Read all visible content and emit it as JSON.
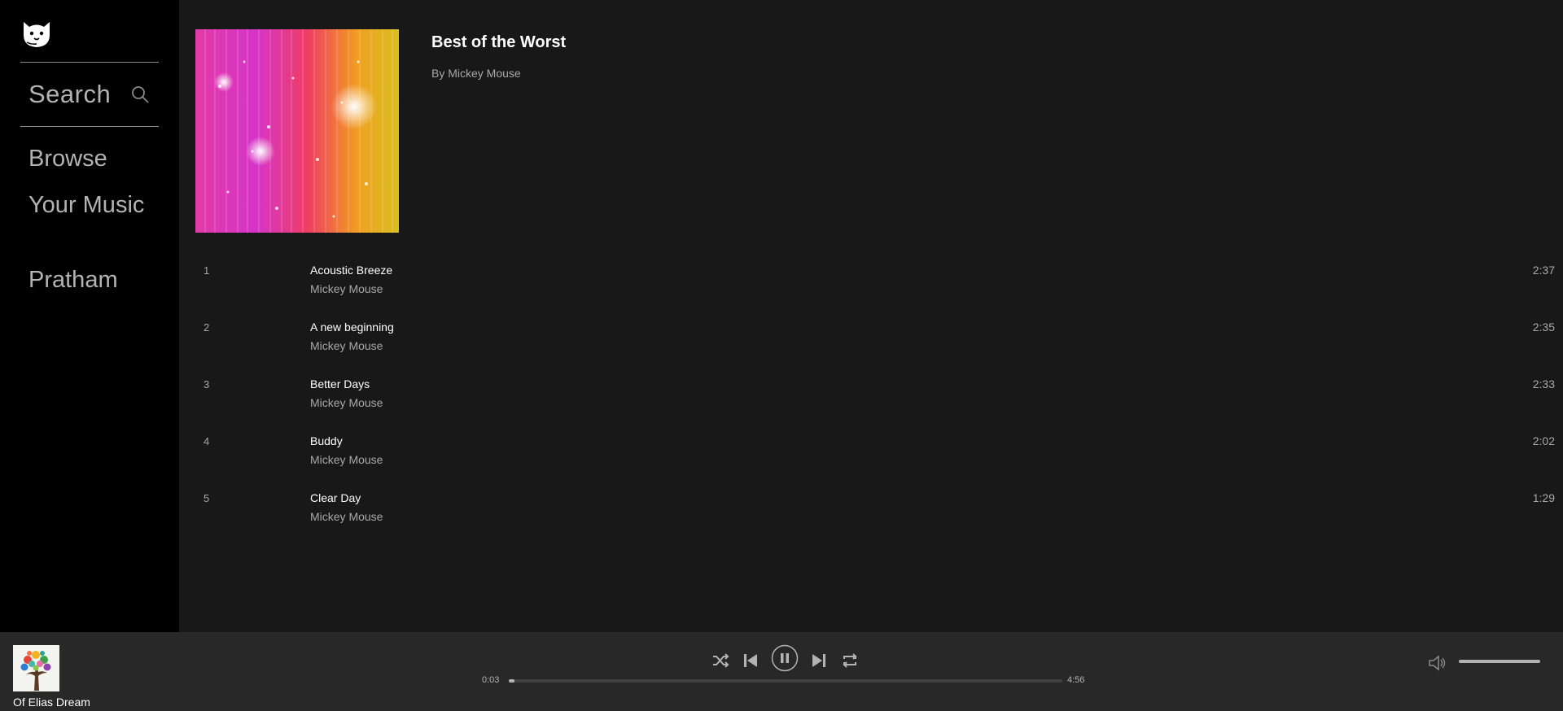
{
  "sidebar": {
    "search_label": "Search",
    "nav": [
      {
        "label": "Browse"
      },
      {
        "label": "Your Music"
      },
      {
        "label": "Pratham"
      }
    ]
  },
  "album": {
    "title": "Best of the Worst",
    "artist_line": "By Mickey Mouse"
  },
  "tracks": [
    {
      "num": "1",
      "title": "Acoustic Breeze",
      "artist": "Mickey Mouse",
      "duration": "2:37"
    },
    {
      "num": "2",
      "title": "A new beginning",
      "artist": "Mickey Mouse",
      "duration": "2:35"
    },
    {
      "num": "3",
      "title": "Better Days",
      "artist": "Mickey Mouse",
      "duration": "2:33"
    },
    {
      "num": "4",
      "title": "Buddy",
      "artist": "Mickey Mouse",
      "duration": "2:02"
    },
    {
      "num": "5",
      "title": "Clear Day",
      "artist": "Mickey Mouse",
      "duration": "1:29"
    }
  ],
  "player": {
    "now_playing_title": "Of Elias Dream",
    "elapsed": "0:03",
    "total": "4:56",
    "progress_fraction": 0.01,
    "volume_fraction": 1.0,
    "state": "playing",
    "icons": [
      "shuffle-icon",
      "previous-icon",
      "pause-icon",
      "next-icon",
      "repeat-icon",
      "volume-icon"
    ]
  },
  "colors": {
    "sidebar_bg": "#000000",
    "main_bg": "#181818",
    "player_bg": "#282828",
    "muted_text": "#a8a8a8"
  }
}
